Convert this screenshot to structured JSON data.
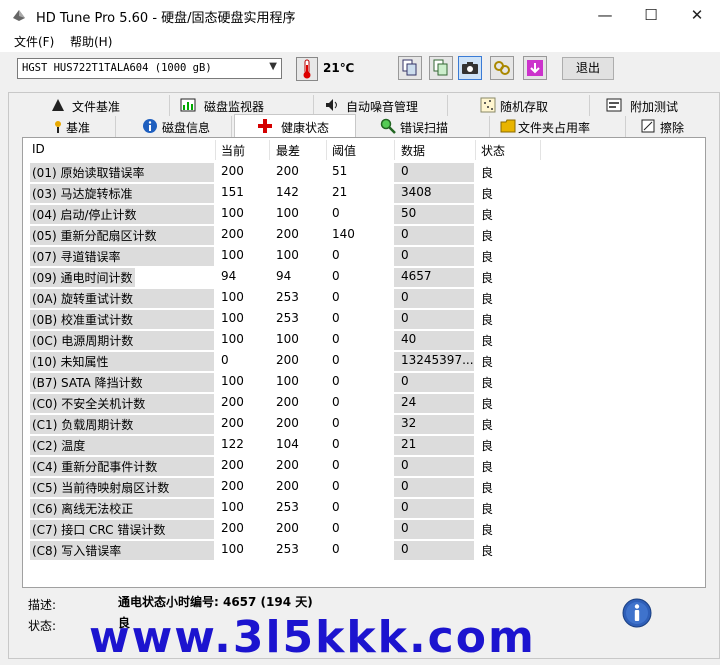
{
  "window": {
    "title": "HD Tune Pro 5.60 - 硬盘/固态硬盘实用程序",
    "minimize": "—",
    "maximize": "☐",
    "close": "✕"
  },
  "menu": [
    {
      "label": "文件(F)"
    },
    {
      "label": "帮助(H)"
    }
  ],
  "toolbar": {
    "drive": "HGST HUS722T1TALA604 (1000 gB)",
    "temperature": "21℃",
    "exit_label": "退出",
    "buttons": [
      "copy-icon",
      "copy-all-icon",
      "camera-icon",
      "link-icon",
      "save-icon"
    ]
  },
  "tabs_top": [
    {
      "label": "文件基准",
      "icon": "file-benchmark-icon"
    },
    {
      "label": "磁盘监视器",
      "icon": "disk-monitor-icon"
    },
    {
      "label": "自动噪音管理",
      "icon": "speaker-icon"
    },
    {
      "label": "随机存取",
      "icon": "random-access-icon"
    },
    {
      "label": "附加测试",
      "icon": "extra-tests-icon"
    }
  ],
  "tabs_bottom": [
    {
      "label": "基准",
      "icon": "benchmark-icon"
    },
    {
      "label": "磁盘信息",
      "icon": "info-icon"
    },
    {
      "label": "健康状态",
      "icon": "health-cross-icon",
      "selected": true
    },
    {
      "label": "错误扫描",
      "icon": "magnifier-icon"
    },
    {
      "label": "文件夹占用率",
      "icon": "folder-icon"
    },
    {
      "label": "擦除",
      "icon": "erase-icon"
    }
  ],
  "table": {
    "columns": [
      "ID",
      "当前",
      "最差",
      "阈值",
      "数据",
      "状态"
    ],
    "rows": [
      [
        "(01) 原始读取错误率",
        "200",
        "200",
        "51",
        "0",
        "良"
      ],
      [
        "(03) 马达旋转标准",
        "151",
        "142",
        "21",
        "3408",
        "良"
      ],
      [
        "(04) 启动/停止计数",
        "100",
        "100",
        "0",
        "50",
        "良"
      ],
      [
        "(05) 重新分配扇区计数",
        "200",
        "200",
        "140",
        "0",
        "良"
      ],
      [
        "(07) 寻道错误率",
        "100",
        "100",
        "0",
        "0",
        "良"
      ],
      [
        "(09) 通电时间计数",
        "94",
        "94",
        "0",
        "4657",
        "良"
      ],
      [
        "(0A) 旋转重试计数",
        "100",
        "253",
        "0",
        "0",
        "良"
      ],
      [
        "(0B) 校准重试计数",
        "100",
        "253",
        "0",
        "0",
        "良"
      ],
      [
        "(0C) 电源周期计数",
        "100",
        "100",
        "0",
        "40",
        "良"
      ],
      [
        "(10) 未知属性",
        "0",
        "200",
        "0",
        "13245397...",
        "良"
      ],
      [
        "(B7) SATA 降挡计数",
        "100",
        "100",
        "0",
        "0",
        "良"
      ],
      [
        "(C0) 不安全关机计数",
        "200",
        "200",
        "0",
        "24",
        "良"
      ],
      [
        "(C1) 负载周期计数",
        "200",
        "200",
        "0",
        "32",
        "良"
      ],
      [
        "(C2) 温度",
        "122",
        "104",
        "0",
        "21",
        "良"
      ],
      [
        "(C4) 重新分配事件计数",
        "200",
        "200",
        "0",
        "0",
        "良"
      ],
      [
        "(C5) 当前待映射扇区计数",
        "200",
        "200",
        "0",
        "0",
        "良"
      ],
      [
        "(C6) 离线无法校正",
        "100",
        "253",
        "0",
        "0",
        "良"
      ],
      [
        "(C7) 接口 CRC 错误计数",
        "200",
        "200",
        "0",
        "0",
        "良"
      ],
      [
        "(C8) 写入错误率",
        "100",
        "253",
        "0",
        "0",
        "良"
      ]
    ]
  },
  "footer": {
    "desc_label": "描述:",
    "desc_value": "通电状态小时编号: 4657 (194 天)",
    "status_label": "状态:",
    "status_value": "良"
  },
  "watermark": "www.3l5kkk.com",
  "colors": {
    "row_shade": "#dcdcdc",
    "watermark": "#1c14cf",
    "info_icon": "#2f5fb8"
  }
}
